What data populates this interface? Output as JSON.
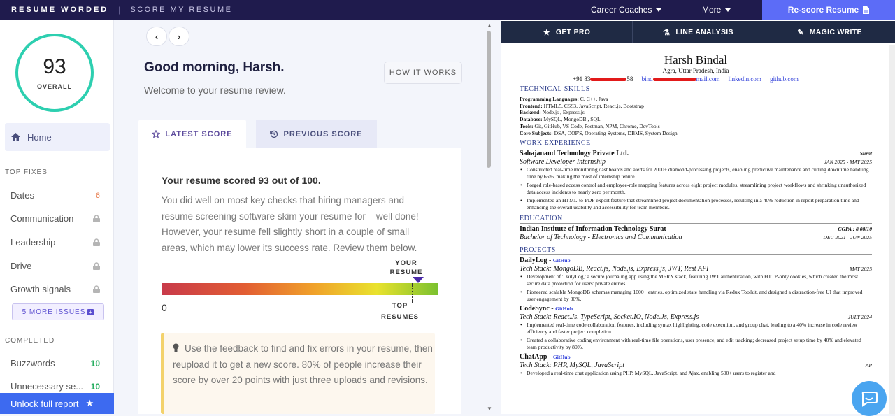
{
  "topbar": {
    "brand": "RESUME WORDED",
    "divider": "|",
    "section": "SCORE MY RESUME",
    "career_coaches": "Career Coaches",
    "more": "More",
    "rescore": "Re-score Resume"
  },
  "sidebar": {
    "score": "93",
    "score_label": "OVERALL",
    "home": "Home",
    "top_fixes_title": "TOP FIXES",
    "fixes": [
      {
        "label": "Dates",
        "badge": "6"
      },
      {
        "label": "Communication"
      },
      {
        "label": "Leadership"
      },
      {
        "label": "Drive"
      },
      {
        "label": "Growth signals"
      }
    ],
    "more_issues": "5 MORE ISSUES",
    "completed_title": "COMPLETED",
    "completed": [
      {
        "label": "Buzzwords",
        "badge": "10"
      },
      {
        "label": "Unnecessary se...",
        "badge": "10"
      }
    ],
    "unlock": "Unlock full report"
  },
  "main": {
    "greeting": "Good morning, Harsh.",
    "welcome": "Welcome to your resume review.",
    "how_it_works": "HOW IT WORKS",
    "tab_latest": "LATEST SCORE",
    "tab_previous": "PREVIOUS SCORE",
    "scored_text": "Your resume scored 93 out of 100.",
    "paragraph": "You did well on most key checks that hiring managers and resume screening software skim your resume for – well done! However, your resume fell slightly short in a couple of small areas, which may lower its success rate. Review them below.",
    "bar_your_resume": "YOUR RESUME",
    "bar_zero": "0",
    "bar_top": "TOP RESUMES",
    "score_fraction": 0.93,
    "tip": "Use the feedback to find and fix errors in your resume, then reupload it to get a new score. 80% of people increase their score by over 20 points with just three uploads and revisions."
  },
  "right_tabs": {
    "get_pro": "GET PRO",
    "line_analysis": "LINE ANALYSIS",
    "magic_write": "MAGIC WRITE"
  },
  "resume": {
    "name": "Harsh Bindal",
    "location": "Agra, Uttar Pradesh, India",
    "phone_prefix": "+91 83",
    "phone_suffix": "58",
    "email_prefix": "bind",
    "email_suffix": "mail.com",
    "linkedin": "linkedin.com",
    "github": "github.com",
    "skills_title": "TECHNICAL SKILLS",
    "skills": [
      {
        "k": "Programming Languages:",
        "v": " C, C++, Java"
      },
      {
        "k": "Frontend:",
        "v": " HTML5, CSS3, JavaScript, React.js, Bootstrap"
      },
      {
        "k": "Backend:",
        "v": " Node.js , Express.js"
      },
      {
        "k": "Database:",
        "v": " MySQL, MongoDB , SQL"
      },
      {
        "k": "Tools:",
        "v": " Git, GitHub, VS Code, Postman, NPM, Chrome, DevTools"
      },
      {
        "k": "Core Subjects:",
        "v": " DSA, OOP'S, Operating Systems, DBMS, System Design"
      }
    ],
    "work_title": "WORK EXPERIENCE",
    "company": "Sahajanand Technology Private Ltd.",
    "company_loc": "Surat",
    "role": "Software Developer Internship",
    "role_dates": "JAN 2025 - MAY 2025",
    "work_bullets": [
      "Constructed real-time monitoring dashboards and alerts for 2000+ diamond-processing projects, enabling predictive maintenance and cutting downtime handling time by 66%, making the most of internship tenure.",
      "Forged role-based access control and employee-role mapping features across eight project modules, streamlining project workflows and shrinking unauthorized data access incidents to nearly zero per month.",
      "Implemented an HTML-to-PDF export feature that streamlined project documentation processes, resulting in a 40% reduction in report preparation time and enhancing the overall usability and accessibility for team members."
    ],
    "edu_title": "EDUCATION",
    "school": "Indian Institute of Information Technology Surat",
    "cgpa": "CGPA : 8.08/10",
    "degree": "Bachelor of Technology - Electronics and Communication",
    "edu_dates": "DEC 2021 - JUN 2025",
    "proj_title": "PROJECTS",
    "projects": [
      {
        "name": "DailyLog",
        "link": "GitHub",
        "stack": "Tech Stack: MongoDB, React.js, Node.js, Express.js, JWT, Rest API",
        "date": "MAY 2025",
        "bullets": [
          "Development of 'DailyLog,' a secure journaling app using the MERN stack, featuring JWT authentication, with HTTP-only cookies, which created the most secure data protection for users' private entries.",
          "Pioneered scalable MongoDB schemas managing 1000+ entries, optimized state handling via Redux Toolkit, and designed a distraction-free UI that improved user engagement by 30%."
        ]
      },
      {
        "name": "CodeSync",
        "link": "GitHub",
        "stack": "Tech Stack: React.Js, TypeScript, Socket.IO, Node.Js, Express.js",
        "date": "JULY 2024",
        "bullets": [
          "Implemented real-time code collaboration features, including syntax highlighting, code execution, and group chat, leading to a 40% increase in code review efficiency and faster project completion.",
          "Created a collaborative coding environment with real-time file operations, user presence, and edit tracking; decreased project setup time by 40% and elevated team productivity by 80%."
        ]
      },
      {
        "name": "ChatApp",
        "link": "GitHub",
        "stack": "Tech Stack: PHP, MySQL, JavaScript",
        "date": "AP",
        "bullets": [
          "Developed a real-time chat application using PHP, MySQL, JavaScript, and Ajax, enabling 500+ users to register and"
        ]
      }
    ]
  },
  "colors": {
    "topbar": "#1f1b4d",
    "accent": "#5c6cf7",
    "ring": "#2dcfb0",
    "unlock": "#3d6af0"
  }
}
